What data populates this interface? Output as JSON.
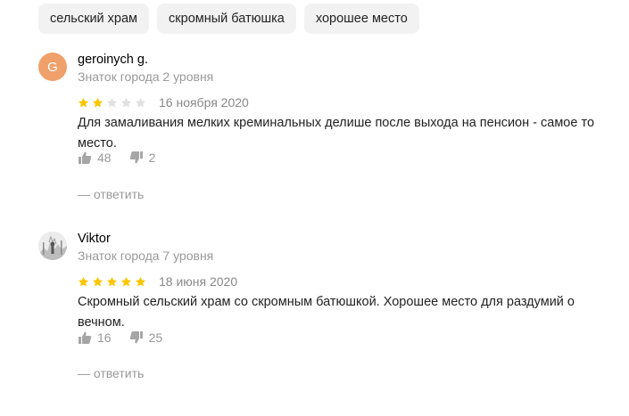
{
  "tags": [
    "сельский храм",
    "скромный батюшка",
    "хорошее место"
  ],
  "reviews": [
    {
      "avatar_letter": "G",
      "author": "geroinych g.",
      "level": "Знаток города 2 уровня",
      "rating": 2,
      "date": "16 ноября 2020",
      "text": "Для замаливания мелких креминальных делише после выхода на пенсион - самое то место.",
      "likes": "48",
      "dislikes": "2",
      "reply": "— ответить"
    },
    {
      "author": "Viktor",
      "level": "Знаток города 7 уровня",
      "rating": 5,
      "date": "18 июня 2020",
      "text": "Скромный сельский храм со скромным батюшкой. Хорошее место для раздумий о вечном.",
      "likes": "16",
      "dislikes": "25",
      "reply": "— ответить"
    }
  ],
  "colors": {
    "star_filled": "#fcc500",
    "star_empty": "#e0e0e0",
    "avatar_bg": "#f0a06a"
  }
}
